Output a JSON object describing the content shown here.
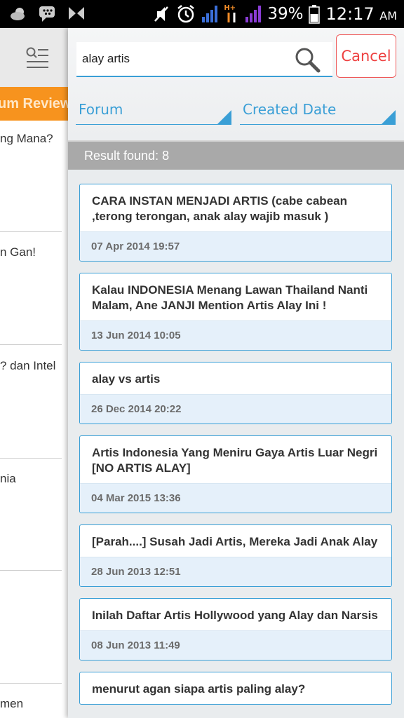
{
  "status_bar": {
    "icons": [
      "weather-icon",
      "bbm-icon",
      "hourglass-icon",
      "mute-icon",
      "alarm-icon",
      "signal-icon",
      "network-type-icon",
      "signal2-icon",
      "battery-icon"
    ],
    "network_type": "H+",
    "battery": "39%",
    "time": "12:17",
    "ampm": "AM"
  },
  "drawer": {
    "header_tab": "um Review",
    "items": [
      "ng Mana?",
      "n Gan!",
      "? dan Intel",
      "nia",
      "men"
    ]
  },
  "search": {
    "query": "alay artis",
    "placeholder": "",
    "cancel_label": "Cancel"
  },
  "filters": {
    "forum_label": "Forum",
    "date_label": "Created Date"
  },
  "result_text": "Result found: 8",
  "results": [
    {
      "title": "CARA INSTAN MENJADI ARTIS (cabe cabean ,terong terongan, anak alay wajib masuk )",
      "date": "07 Apr 2014 19:57"
    },
    {
      "title": "Kalau INDONESIA Menang Lawan Thailand Nanti Malam, Ane JANJI Mention Artis Alay Ini !",
      "date": "13 Jun 2014 10:05"
    },
    {
      "title": "alay vs artis",
      "date": "26 Dec 2014 20:22"
    },
    {
      "title": "Artis Indonesia Yang Meniru Gaya Artis Luar Negri [NO ARTIS ALAY]",
      "date": "04 Mar 2015 13:36"
    },
    {
      "title": "[Parah....] Susah Jadi Artis, Mereka Jadi Anak Alay",
      "date": "28 Jun 2013 12:51"
    },
    {
      "title": "Inilah Daftar Artis Hollywood yang Alay dan Narsis",
      "date": "08 Jun 2013 11:49"
    },
    {
      "title": "menurut agan siapa artis paling alay?",
      "date": ""
    }
  ],
  "colors": {
    "accent": "#3a9fd6",
    "cancel": "#ee4040",
    "drawer_tab": "#f7931e",
    "result_bar": "#a9a9a9",
    "date_bg": "#e5f0fa"
  }
}
